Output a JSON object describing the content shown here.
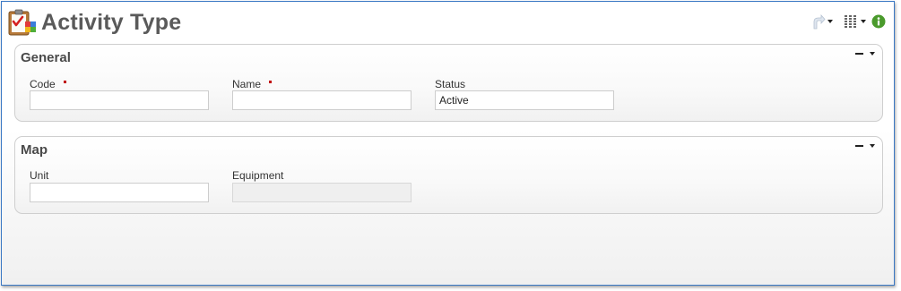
{
  "header": {
    "title": "Activity Type",
    "icons": {
      "app": "clipboard-checklist-icon",
      "share": "share-arrow-icon",
      "columns": "columns-icon",
      "info": "info-icon"
    }
  },
  "colors": {
    "window_border": "#3a78c4",
    "title_text": "#5a5a5a",
    "required_marker": "#c00000",
    "info_green": "#4a9a2c"
  },
  "sections": {
    "general": {
      "title": "General",
      "fields": {
        "code": {
          "label": "Code",
          "value": "",
          "required": true
        },
        "name": {
          "label": "Name",
          "value": "",
          "required": true
        },
        "status": {
          "label": "Status",
          "value": "Active",
          "required": false
        }
      }
    },
    "map": {
      "title": "Map",
      "fields": {
        "unit": {
          "label": "Unit",
          "value": "",
          "required": false
        },
        "equipment": {
          "label": "Equipment",
          "value": "",
          "required": false,
          "disabled": true
        }
      }
    }
  }
}
